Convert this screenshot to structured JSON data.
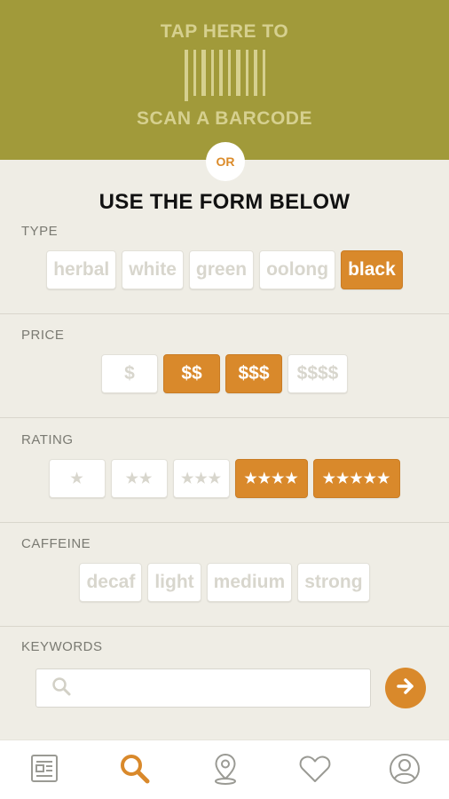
{
  "scan": {
    "line1": "TAP HERE TO",
    "line2": "SCAN A BARCODE",
    "icon": "barcode-icon"
  },
  "or_label": "OR",
  "form_title": "USE THE FORM BELOW",
  "type": {
    "label": "TYPE",
    "options": [
      "herbal",
      "white",
      "green",
      "oolong",
      "black"
    ],
    "selected": "black"
  },
  "price": {
    "label": "PRICE",
    "options": [
      "$",
      "$$",
      "$$$",
      "$$$$"
    ],
    "selected": [
      "$$",
      "$$$"
    ]
  },
  "rating": {
    "label": "RATING",
    "options": [
      "★",
      "★★",
      "★★★",
      "★★★★",
      "★★★★★"
    ],
    "selected": [
      "★★★★",
      "★★★★★"
    ]
  },
  "caffeine": {
    "label": "CAFFEINE",
    "options": [
      "decaf",
      "light",
      "medium",
      "strong"
    ],
    "selected": []
  },
  "keywords": {
    "label": "KEYWORDS",
    "placeholder": "",
    "value": ""
  },
  "tabs": [
    {
      "name": "news-icon",
      "active": false
    },
    {
      "name": "search-icon",
      "active": true
    },
    {
      "name": "location-pin-icon",
      "active": false
    },
    {
      "name": "heart-icon",
      "active": false
    },
    {
      "name": "profile-icon",
      "active": false
    }
  ],
  "colors": {
    "banner": "#a19a3a",
    "accent": "#d9892b",
    "background": "#efede5"
  }
}
